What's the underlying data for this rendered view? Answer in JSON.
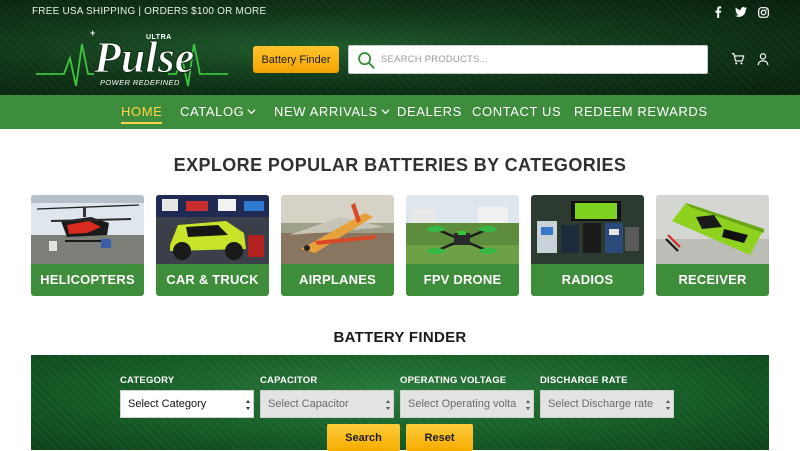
{
  "header": {
    "promo": "FREE USA SHIPPING | ORDERS $100 OR MORE",
    "logo": {
      "main": "Pulse",
      "super": "ULTRA",
      "tagline": "POWER REDEFINED",
      "accent": "#3ec43e"
    },
    "social_icons": [
      "facebook-icon",
      "twitter-icon",
      "instagram-icon"
    ],
    "battery_finder_label": "Battery Finder",
    "search_placeholder": "SEARCH PRODUCTS...",
    "icons": [
      "cart-icon",
      "user-icon"
    ]
  },
  "nav": {
    "items": [
      {
        "label": "HOME",
        "active": true
      },
      {
        "label": "CATALOG",
        "dropdown": true
      },
      {
        "label": "NEW ARRIVALS",
        "dropdown": true
      },
      {
        "label": "DEALERS"
      },
      {
        "label": "CONTACT US"
      },
      {
        "label": "REDEEM REWARDS"
      }
    ],
    "active_color": "#ffd34a",
    "background": "#3d8d3d"
  },
  "categories": {
    "title": "EXPLORE POPULAR BATTERIES BY CATEGORIES",
    "items": [
      {
        "label": "HELICOPTERS"
      },
      {
        "label": "CAR & TRUCK"
      },
      {
        "label": "AIRPLANES"
      },
      {
        "label": "FPV DRONE"
      },
      {
        "label": "RADIOS"
      },
      {
        "label": "RECEIVER"
      }
    ]
  },
  "finder": {
    "title": "BATTERY FINDER",
    "fields": [
      {
        "label": "CATEGORY",
        "value": "Select Category"
      },
      {
        "label": "CAPACITOR",
        "value": "Select Capacitor"
      },
      {
        "label": "OPERATING VOLTAGE",
        "value": "Select Operating volta"
      },
      {
        "label": "DISCHARGE RATE",
        "value": "Select Discharge rate"
      }
    ],
    "search_label": "Search",
    "reset_label": "Reset"
  }
}
